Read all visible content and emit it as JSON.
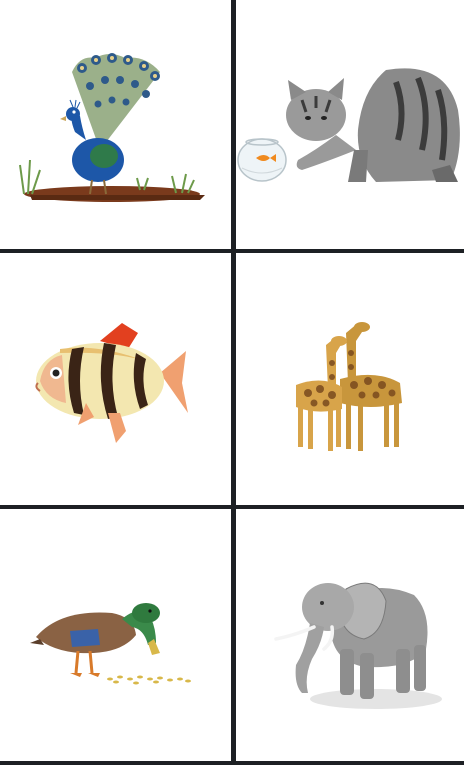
{
  "grid": {
    "cells": [
      {
        "icon": "peacock-icon"
      },
      {
        "icon": "cat-icon"
      },
      {
        "icon": "fish-icon"
      },
      {
        "icon": "giraffe-icon"
      },
      {
        "icon": "duck-icon"
      },
      {
        "icon": "elephant-icon"
      }
    ]
  },
  "colors": {
    "background": "#1d2024",
    "cell": "#ffffff"
  }
}
